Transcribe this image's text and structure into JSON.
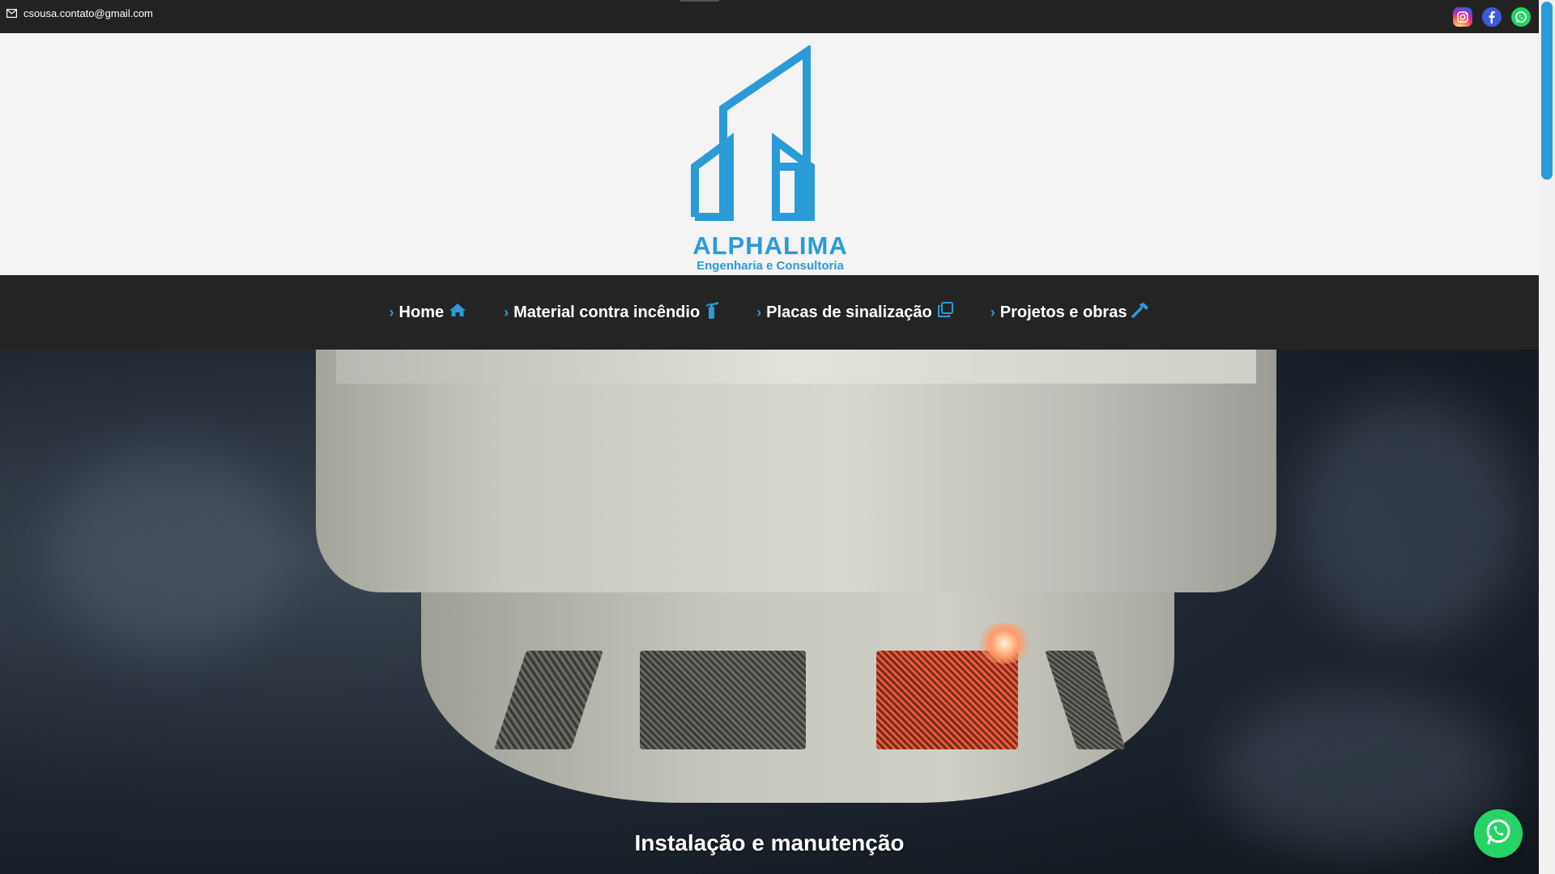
{
  "topbar": {
    "email": "csousa.contato@gmail.com",
    "email_icon": "envelope-icon",
    "socials": [
      "instagram-icon",
      "facebook-icon",
      "whatsapp-icon"
    ]
  },
  "logo": {
    "name": "ALPHALIMA",
    "subtitle": "Engenharia e Consultoria",
    "color": "#2b9bd8"
  },
  "nav": {
    "items": [
      {
        "label": "Home",
        "icon": "home-icon"
      },
      {
        "label": "Material contra incêndio",
        "icon": "fire-extinguisher-icon"
      },
      {
        "label": "Placas de sinalização",
        "icon": "clone-icon"
      },
      {
        "label": "Projetos e obras",
        "icon": "hammer-icon"
      }
    ]
  },
  "hero": {
    "title": "Instalação e manutenção"
  },
  "colors": {
    "accent": "#2b9bd8",
    "topbar_bg": "#222222",
    "nav_bg": "#242424",
    "whatsapp": "#25d366"
  }
}
